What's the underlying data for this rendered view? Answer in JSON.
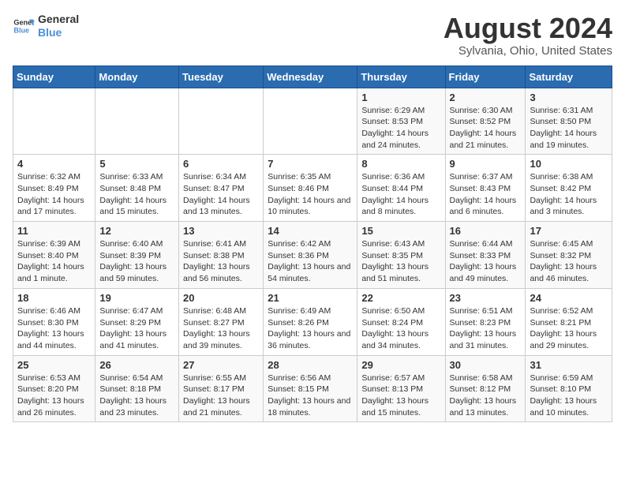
{
  "logo": {
    "line1": "General",
    "line2": "Blue"
  },
  "title": "August 2024",
  "subtitle": "Sylvania, Ohio, United States",
  "days_of_week": [
    "Sunday",
    "Monday",
    "Tuesday",
    "Wednesday",
    "Thursday",
    "Friday",
    "Saturday"
  ],
  "weeks": [
    [
      {
        "day": "",
        "info": ""
      },
      {
        "day": "",
        "info": ""
      },
      {
        "day": "",
        "info": ""
      },
      {
        "day": "",
        "info": ""
      },
      {
        "day": "1",
        "info": "Sunrise: 6:29 AM\nSunset: 8:53 PM\nDaylight: 14 hours and 24 minutes."
      },
      {
        "day": "2",
        "info": "Sunrise: 6:30 AM\nSunset: 8:52 PM\nDaylight: 14 hours and 21 minutes."
      },
      {
        "day": "3",
        "info": "Sunrise: 6:31 AM\nSunset: 8:50 PM\nDaylight: 14 hours and 19 minutes."
      }
    ],
    [
      {
        "day": "4",
        "info": "Sunrise: 6:32 AM\nSunset: 8:49 PM\nDaylight: 14 hours and 17 minutes."
      },
      {
        "day": "5",
        "info": "Sunrise: 6:33 AM\nSunset: 8:48 PM\nDaylight: 14 hours and 15 minutes."
      },
      {
        "day": "6",
        "info": "Sunrise: 6:34 AM\nSunset: 8:47 PM\nDaylight: 14 hours and 13 minutes."
      },
      {
        "day": "7",
        "info": "Sunrise: 6:35 AM\nSunset: 8:46 PM\nDaylight: 14 hours and 10 minutes."
      },
      {
        "day": "8",
        "info": "Sunrise: 6:36 AM\nSunset: 8:44 PM\nDaylight: 14 hours and 8 minutes."
      },
      {
        "day": "9",
        "info": "Sunrise: 6:37 AM\nSunset: 8:43 PM\nDaylight: 14 hours and 6 minutes."
      },
      {
        "day": "10",
        "info": "Sunrise: 6:38 AM\nSunset: 8:42 PM\nDaylight: 14 hours and 3 minutes."
      }
    ],
    [
      {
        "day": "11",
        "info": "Sunrise: 6:39 AM\nSunset: 8:40 PM\nDaylight: 14 hours and 1 minute."
      },
      {
        "day": "12",
        "info": "Sunrise: 6:40 AM\nSunset: 8:39 PM\nDaylight: 13 hours and 59 minutes."
      },
      {
        "day": "13",
        "info": "Sunrise: 6:41 AM\nSunset: 8:38 PM\nDaylight: 13 hours and 56 minutes."
      },
      {
        "day": "14",
        "info": "Sunrise: 6:42 AM\nSunset: 8:36 PM\nDaylight: 13 hours and 54 minutes."
      },
      {
        "day": "15",
        "info": "Sunrise: 6:43 AM\nSunset: 8:35 PM\nDaylight: 13 hours and 51 minutes."
      },
      {
        "day": "16",
        "info": "Sunrise: 6:44 AM\nSunset: 8:33 PM\nDaylight: 13 hours and 49 minutes."
      },
      {
        "day": "17",
        "info": "Sunrise: 6:45 AM\nSunset: 8:32 PM\nDaylight: 13 hours and 46 minutes."
      }
    ],
    [
      {
        "day": "18",
        "info": "Sunrise: 6:46 AM\nSunset: 8:30 PM\nDaylight: 13 hours and 44 minutes."
      },
      {
        "day": "19",
        "info": "Sunrise: 6:47 AM\nSunset: 8:29 PM\nDaylight: 13 hours and 41 minutes."
      },
      {
        "day": "20",
        "info": "Sunrise: 6:48 AM\nSunset: 8:27 PM\nDaylight: 13 hours and 39 minutes."
      },
      {
        "day": "21",
        "info": "Sunrise: 6:49 AM\nSunset: 8:26 PM\nDaylight: 13 hours and 36 minutes."
      },
      {
        "day": "22",
        "info": "Sunrise: 6:50 AM\nSunset: 8:24 PM\nDaylight: 13 hours and 34 minutes."
      },
      {
        "day": "23",
        "info": "Sunrise: 6:51 AM\nSunset: 8:23 PM\nDaylight: 13 hours and 31 minutes."
      },
      {
        "day": "24",
        "info": "Sunrise: 6:52 AM\nSunset: 8:21 PM\nDaylight: 13 hours and 29 minutes."
      }
    ],
    [
      {
        "day": "25",
        "info": "Sunrise: 6:53 AM\nSunset: 8:20 PM\nDaylight: 13 hours and 26 minutes."
      },
      {
        "day": "26",
        "info": "Sunrise: 6:54 AM\nSunset: 8:18 PM\nDaylight: 13 hours and 23 minutes."
      },
      {
        "day": "27",
        "info": "Sunrise: 6:55 AM\nSunset: 8:17 PM\nDaylight: 13 hours and 21 minutes."
      },
      {
        "day": "28",
        "info": "Sunrise: 6:56 AM\nSunset: 8:15 PM\nDaylight: 13 hours and 18 minutes."
      },
      {
        "day": "29",
        "info": "Sunrise: 6:57 AM\nSunset: 8:13 PM\nDaylight: 13 hours and 15 minutes."
      },
      {
        "day": "30",
        "info": "Sunrise: 6:58 AM\nSunset: 8:12 PM\nDaylight: 13 hours and 13 minutes."
      },
      {
        "day": "31",
        "info": "Sunrise: 6:59 AM\nSunset: 8:10 PM\nDaylight: 13 hours and 10 minutes."
      }
    ]
  ]
}
